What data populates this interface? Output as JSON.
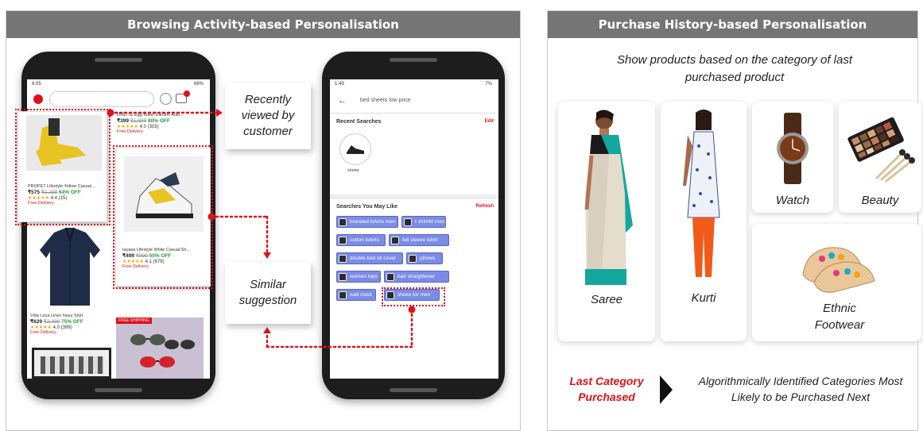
{
  "left_panel": {
    "title": "Browsing Activity-based Personalisation",
    "phone1": {
      "status_time": "8:05",
      "status_right": "68%",
      "products": [
        {
          "name": "PROPET Lifestyle Yellow Casual ...",
          "price": "₹575",
          "mrp": "₹1,299",
          "discount": "64% OFF",
          "rating": "4.4 (15)",
          "delivery": "Free Delivery"
        },
        {
          "name": "OMLITE Egg Boiler Electric Auto...",
          "price": "₹399",
          "mrp": "₹1,999",
          "discount": "80% OFF",
          "rating": "4.0 (303)",
          "delivery": "Free Delivery"
        },
        {
          "name": "Iayasa Lifestyle White Casual Sh...",
          "price": "₹499",
          "mrp": "₹999",
          "discount": "50% OFF",
          "rating": "4.1 (678)",
          "delivery": "Free Delivery"
        },
        {
          "name": "Vida Loca Linen Navy Shirt",
          "price": "₹629",
          "mrp": "₹2,499",
          "discount": "75% OFF",
          "rating": "4.0 (399)",
          "delivery": "Free Delivery"
        }
      ],
      "badge": "FREE SHIPPING"
    },
    "phone2": {
      "status_time": "1:49",
      "status_right": "7%",
      "search_query": "bed sheets low price",
      "recent_title": "Recent Searches",
      "recent_action": "Edit",
      "recent_item": "shoes",
      "like_title": "Searches You May Like",
      "like_action": "Refresh",
      "chips": [
        "branded tshirts men",
        "t shirt40 men",
        "cotton tshirts",
        "full sleeve tshirt",
        "double bed sit cover",
        "pillows",
        "women tops",
        "hair straightener",
        "wall clock",
        "shoes for men"
      ]
    },
    "callout_recent": "Recently viewed by customer",
    "callout_similar": "Similar suggestion"
  },
  "right_panel": {
    "title": "Purchase History-based Personalisation",
    "subtitle": "Show products based on the category of last purchased product",
    "categories": [
      "Saree",
      "Kurti",
      "Watch",
      "Beauty",
      "Ethnic Footwear"
    ],
    "legend_last": "Last Category Purchased",
    "legend_next": "Algorithmically Identified Categories Most Likely to be Purchased Next"
  },
  "colors": {
    "accent_red": "#e0101a",
    "header_gray": "#757575",
    "chip_blue": "#7b8be6"
  }
}
